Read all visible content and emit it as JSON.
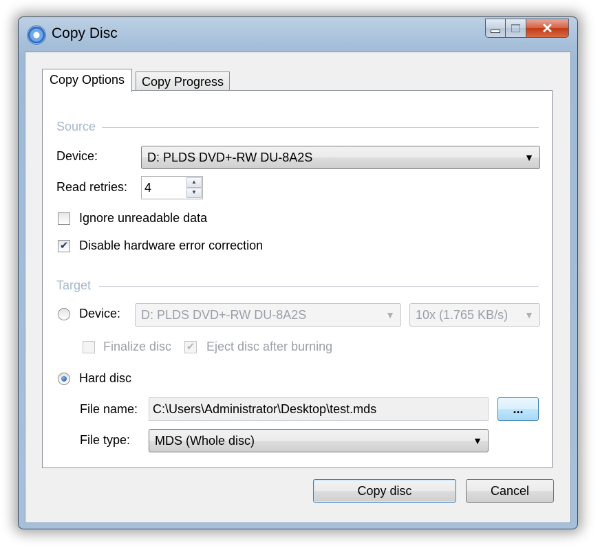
{
  "window": {
    "title": "Copy Disc",
    "icon": "disc-copy-icon"
  },
  "caption_buttons": {
    "minimize": "minimize-icon",
    "maximize": "maximize-icon",
    "close": "close-icon"
  },
  "tabs": [
    {
      "label": "Copy Options",
      "active": true
    },
    {
      "label": "Copy Progress",
      "active": false
    }
  ],
  "source": {
    "group_label": "Source",
    "device_label": "Device:",
    "device_value": "D: PLDS DVD+-RW DU-8A2S",
    "retries_label": "Read retries:",
    "retries_value": "4",
    "ignore_label": "Ignore unreadable data",
    "ignore_checked": false,
    "disable_ecc_label": "Disable hardware error correction",
    "disable_ecc_checked": true
  },
  "target": {
    "group_label": "Target",
    "device_label": "Device:",
    "device_value": "D: PLDS DVD+-RW DU-8A2S",
    "speed_value": "10x (1.765 KB/s)",
    "finalize_label": "Finalize disc",
    "finalize_checked": false,
    "eject_label": "Eject disc after burning",
    "eject_checked": true,
    "hard_disc_label": "Hard disc",
    "hard_disc_selected": true,
    "file_name_label": "File name:",
    "file_name_value": "C:\\Users\\Administrator\\Desktop\\test.mds",
    "browse_label": "...",
    "file_type_label": "File type:",
    "file_type_value": "MDS (Whole disc)"
  },
  "buttons": {
    "copy": "Copy disc",
    "cancel": "Cancel"
  }
}
